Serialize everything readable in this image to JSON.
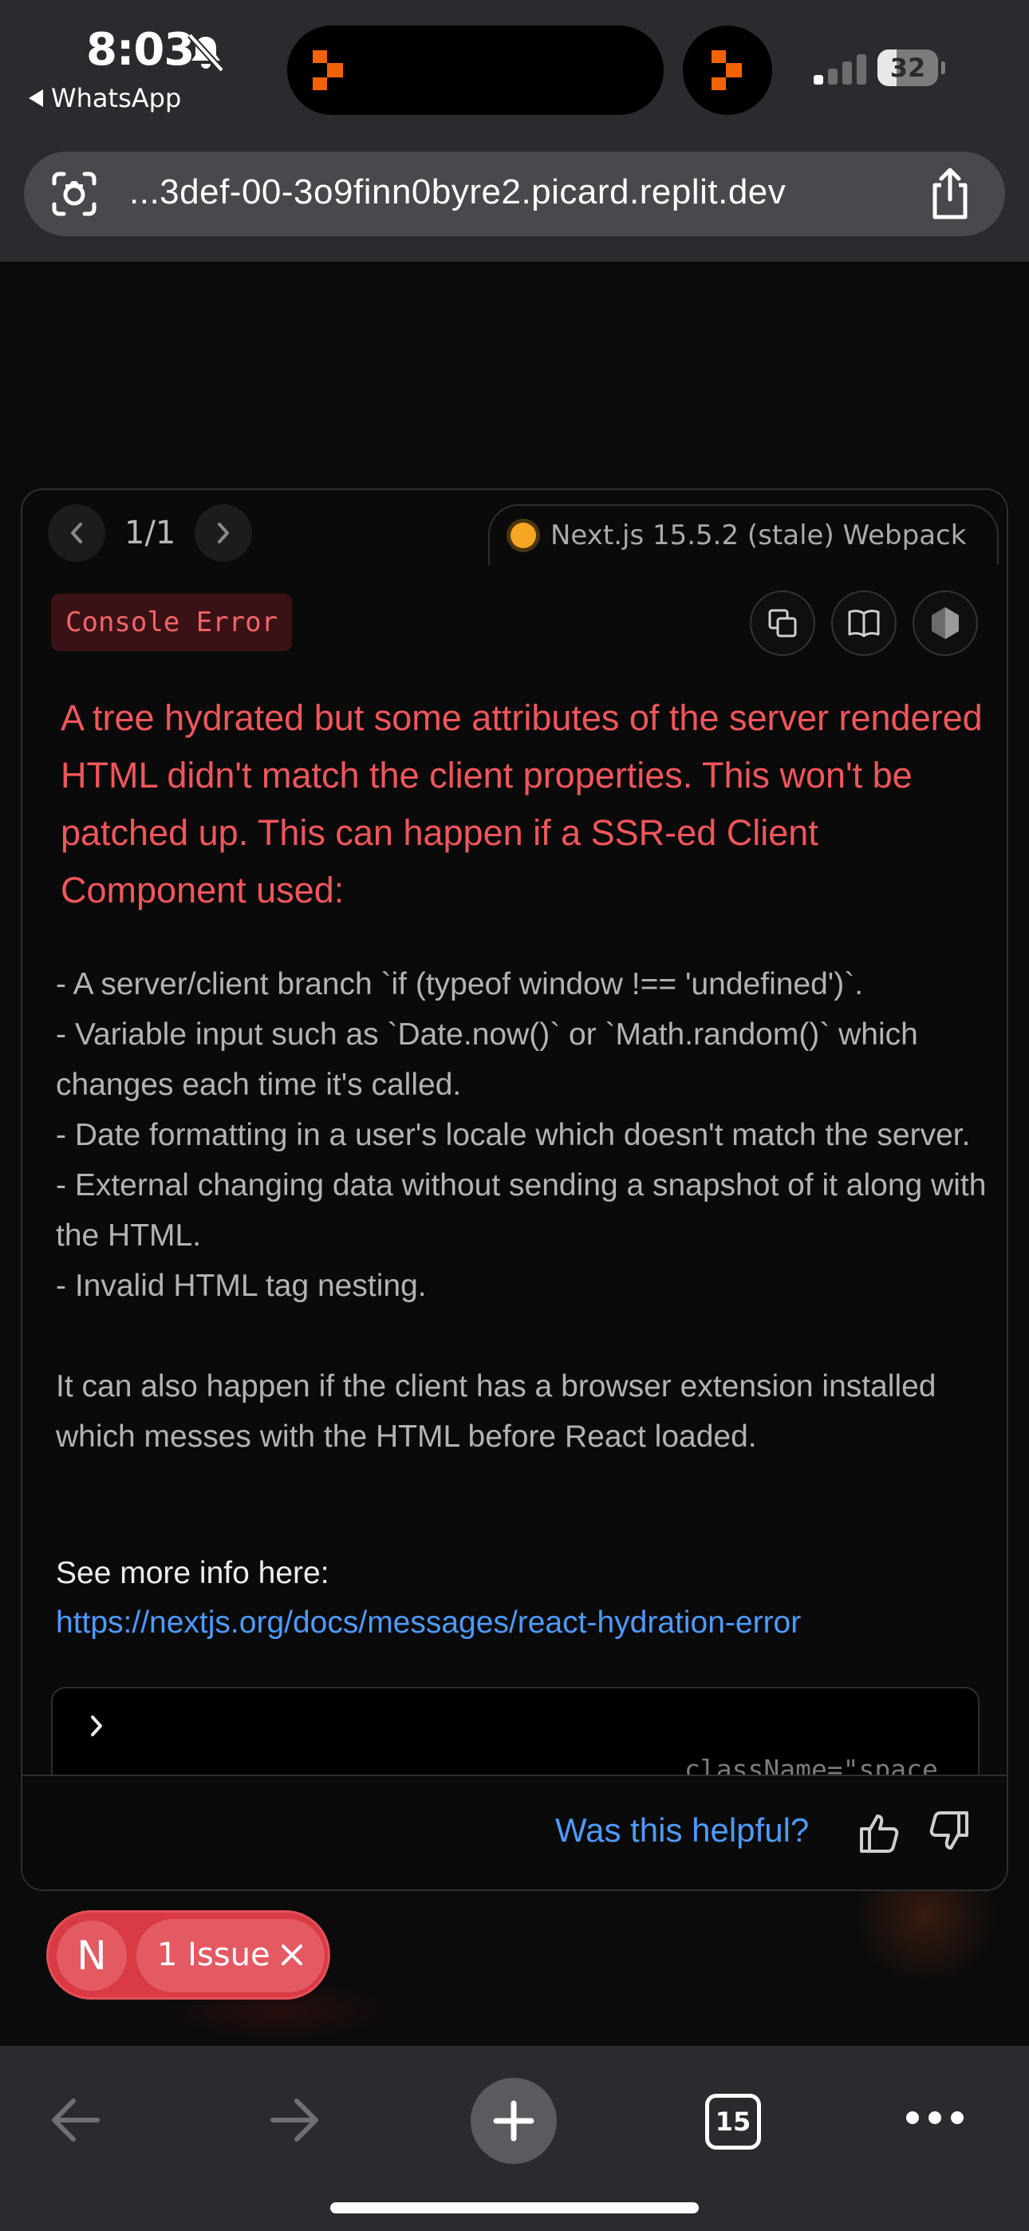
{
  "status_bar": {
    "time": "8:03",
    "back_app": "WhatsApp",
    "battery": "32",
    "battery_level": 0.32
  },
  "browser": {
    "url": "...3def-00-3o9finn0byre2.picard.replit.dev",
    "tab_count": "15"
  },
  "overlay": {
    "pager": "1/1",
    "version": "Next.js 15.5.2 (stale) Webpack",
    "badge": "Console Error",
    "headline": "A tree hydrated but some attributes of the server rendered HTML didn't match the client properties. This won't be patched up. This can happen if a SSR-ed Client Component used:",
    "description": "- A server/client branch `if (typeof window !== 'undefined')`.\n- Variable input such as `Date.now()` or `Math.random()` which changes each time it's called.\n- Date formatting in a user's locale which doesn't match the server.\n- External changing data without sending a snapshot of it along with the HTML.\n- Invalid HTML tag nesting.\n\nIt can also happen if the client has a browser extension installed which messes with the HTML before React loaded.",
    "see_more": "See more info here:",
    "link": "https://nextjs.org/docs/messages/react-hydration-error",
    "code_snippet": "className=\"space",
    "helpful": "Was this helpful?"
  },
  "issue_badge": {
    "initial": "N",
    "label": "1 Issue"
  },
  "colors": {
    "error": "#f0565c",
    "link": "#4e9bff",
    "badge_bg": "#d93a43",
    "version_dot": "#f5a623"
  }
}
